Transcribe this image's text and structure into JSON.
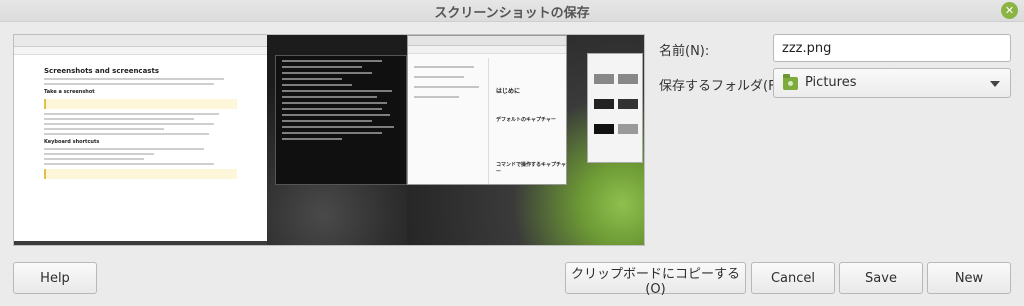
{
  "window": {
    "title": "スクリーンショットの保存",
    "close_icon": "close-icon",
    "close_glyph": "✕",
    "accent_color": "#8ab544"
  },
  "preview": {
    "doc_heading": "Screenshots and screencasts",
    "doc_subheading": "Take a screenshot",
    "doc_subheading2": "Keyboard shortcuts",
    "desk_heading1": "はじめに",
    "desk_heading2": "デフォルトのキャプチャー",
    "desk_heading3": "コマンドで操作するキャプチャー"
  },
  "form": {
    "name_label": "名前(N):",
    "name_value": "zzz.png",
    "folder_label": "保存するフォルダ(F):",
    "folder_value": "Pictures",
    "folder_icon": "folder-pictures-icon"
  },
  "buttons": {
    "help": "Help",
    "copy_clipboard": "クリップボードにコピーする(O)",
    "cancel": "Cancel",
    "save": "Save",
    "new": "New"
  }
}
